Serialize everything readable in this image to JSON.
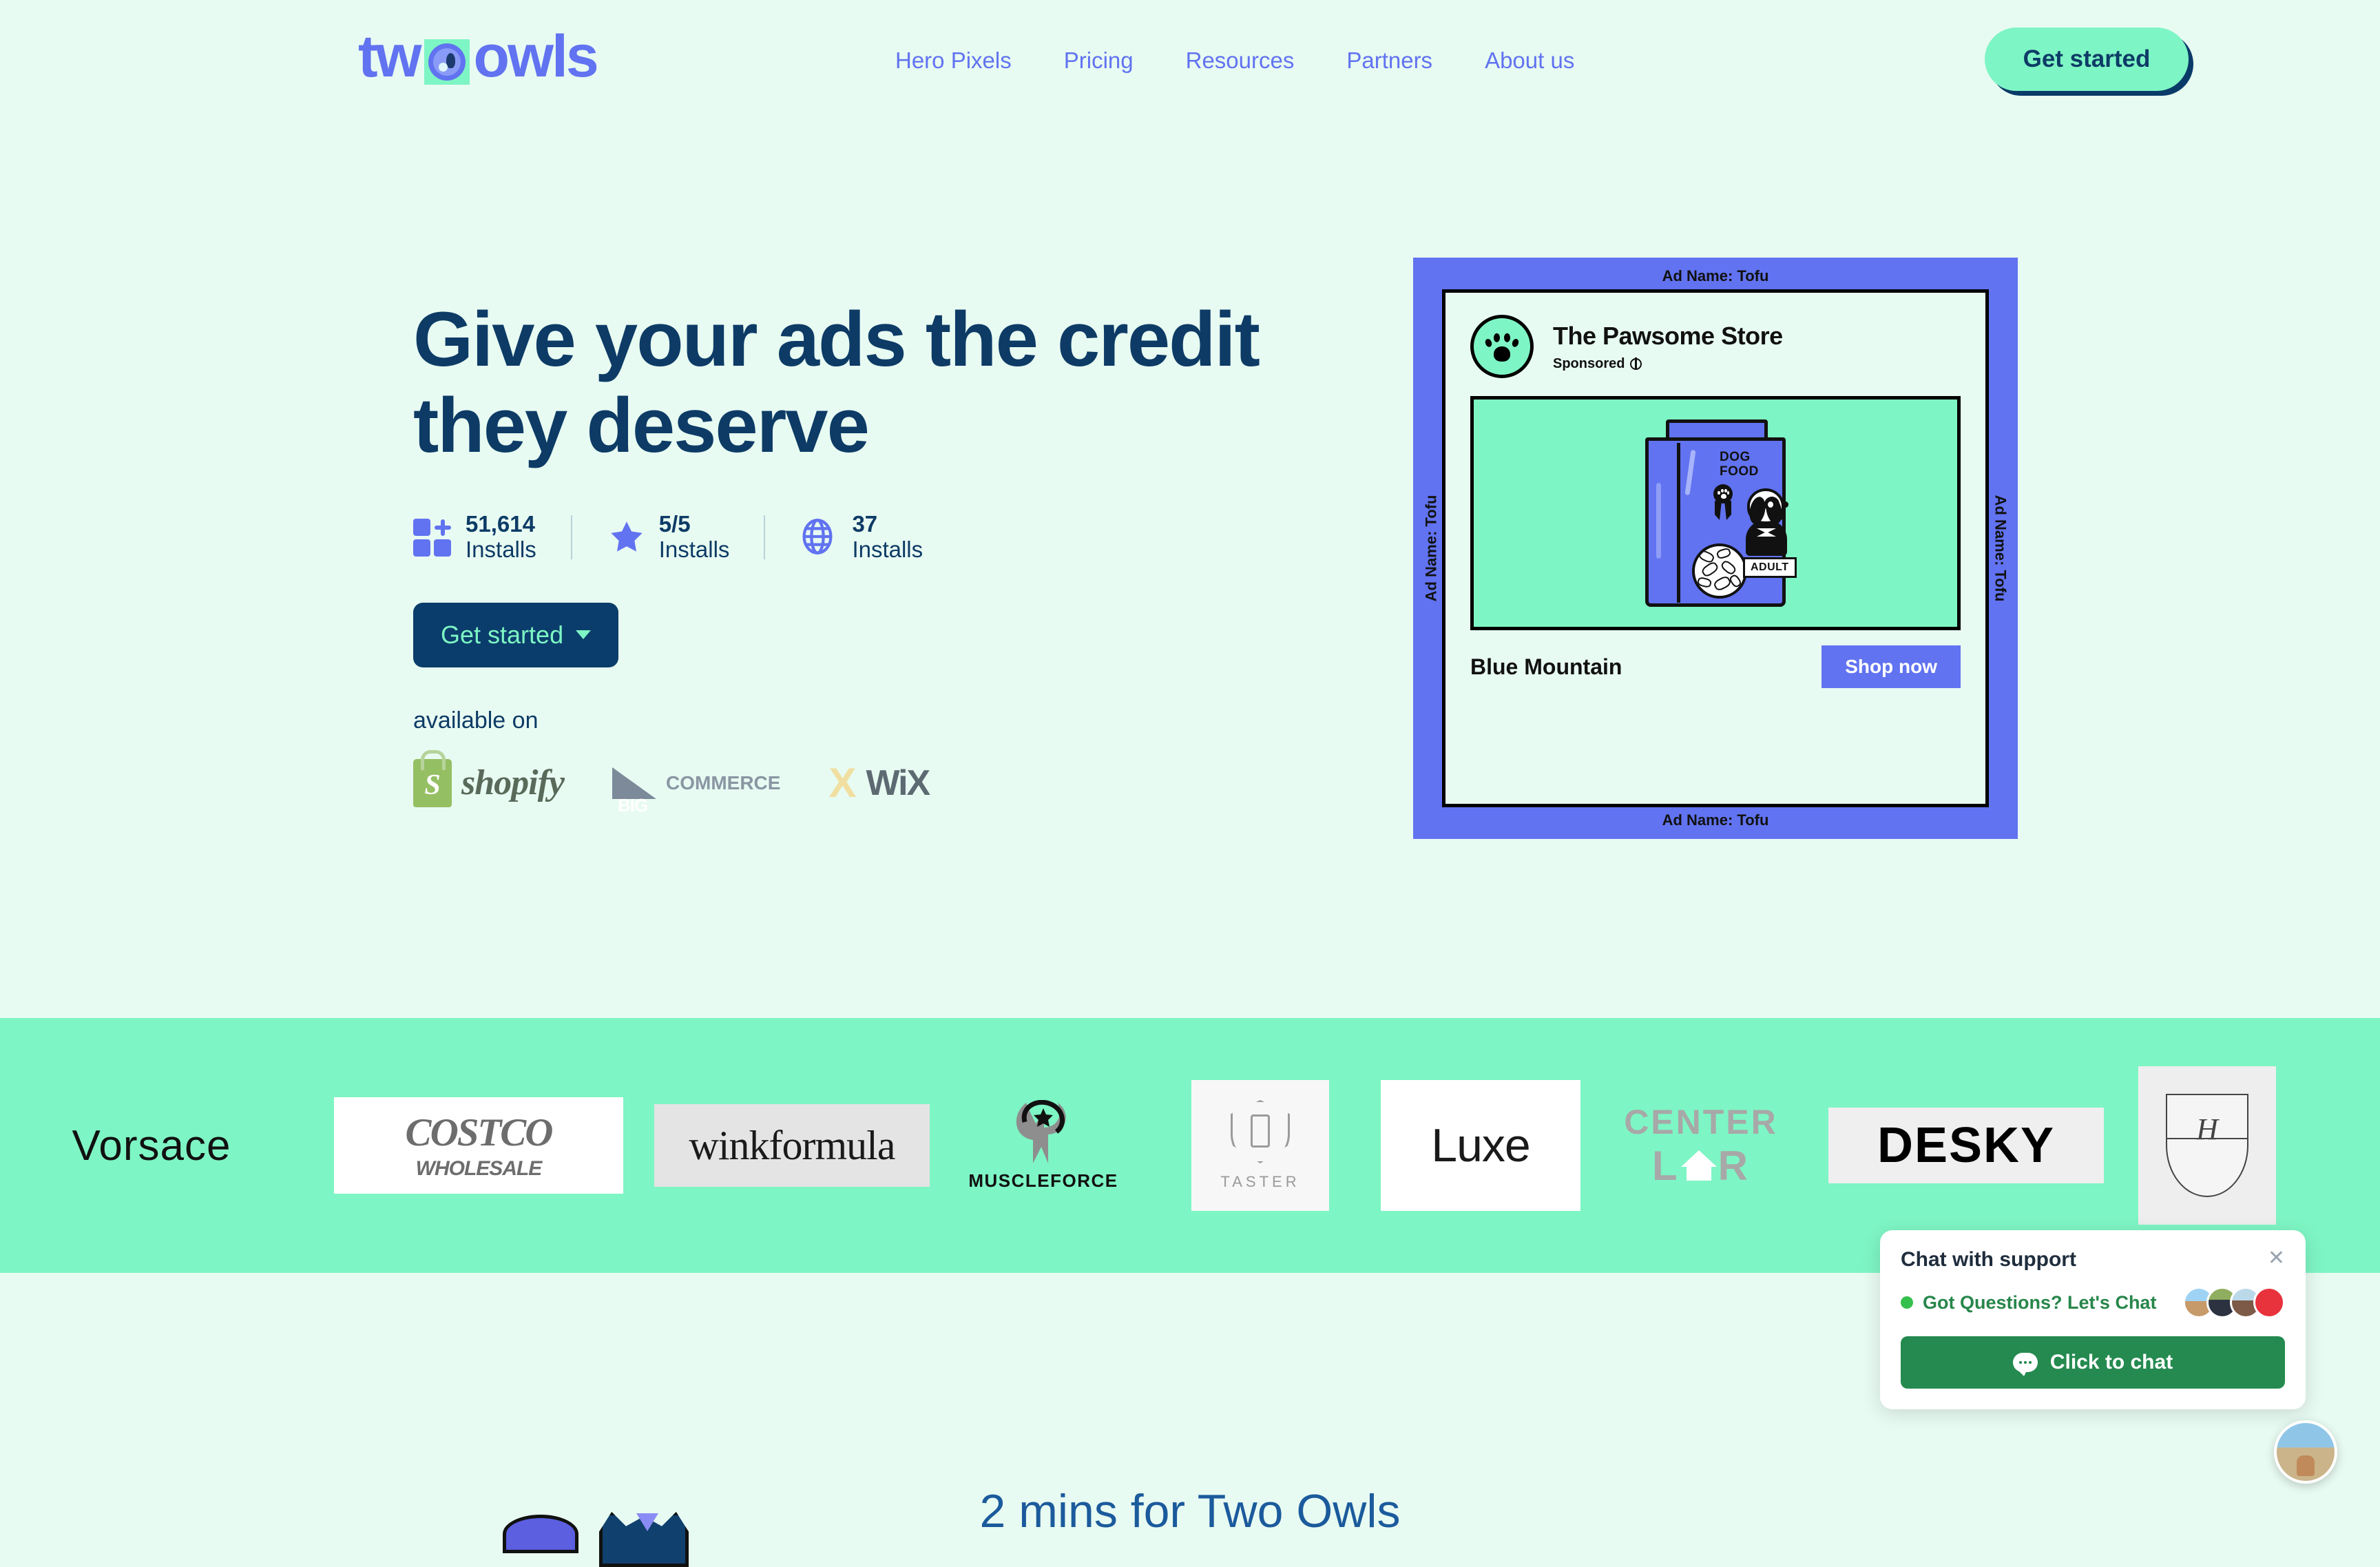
{
  "header": {
    "logo": {
      "text_left": "tw",
      "text_right": "owls",
      "mark": "owl-circle-logo"
    },
    "nav": [
      {
        "label": "Hero Pixels"
      },
      {
        "label": "Pricing"
      },
      {
        "label": "Resources"
      },
      {
        "label": "Partners"
      },
      {
        "label": "About us"
      }
    ],
    "cta_label": "Get started"
  },
  "hero": {
    "title_line1": "Give your ads the credit",
    "title_line2": "they deserve",
    "stats": [
      {
        "icon": "grid-plus-icon",
        "value": "51,614",
        "label": "Installs"
      },
      {
        "icon": "star-icon",
        "value": "5/5",
        "label": "Installs"
      },
      {
        "icon": "globe-icon",
        "value": "37",
        "label": "Installs"
      }
    ],
    "cta_label": "Get started",
    "available_label": "available on",
    "platforms": [
      {
        "name": "shopify-logo",
        "word": "shopify"
      },
      {
        "name": "bigcommerce-logo",
        "prefix": "BIG",
        "word": "COMMERCE"
      },
      {
        "name": "wix-logo",
        "mark": "X",
        "word": "WiX"
      }
    ]
  },
  "ad_card": {
    "edge_label": "Ad Name: Tofu",
    "store_name": "The Pawsome Store",
    "sponsored_label": "Sponsored",
    "avatar_icon": "paw-print-icon",
    "product": {
      "bag_label_line1": "DOG",
      "bag_label_line2": "FOOD",
      "badge": "ADULT"
    },
    "brand_name": "Blue Mountain",
    "shop_label": "Shop now"
  },
  "brands": [
    {
      "name": "Vorsace"
    },
    {
      "name": "COSTCO",
      "sub": "WHOLESALE"
    },
    {
      "name": "winkformula"
    },
    {
      "name": "MUSCLEFORCE"
    },
    {
      "name": "TASTER"
    },
    {
      "name": "Luxe"
    },
    {
      "name": "CENTER",
      "sub": "L R"
    },
    {
      "name": "DESKY"
    },
    {
      "name": "H"
    }
  ],
  "chat": {
    "title": "Chat with support",
    "status_text": "Got Questions? Let's Chat",
    "button_label": "Click to chat",
    "close_icon": "close-icon",
    "status_color": "#35c04e",
    "button_color": "#248a4f"
  },
  "bottom": {
    "title": "2 mins for Two Owls"
  },
  "colors": {
    "page_bg": "#e8fbf2",
    "brand_blue": "#6173f0",
    "deep_navy": "#0d3b66",
    "mint": "#7ef5c4"
  }
}
